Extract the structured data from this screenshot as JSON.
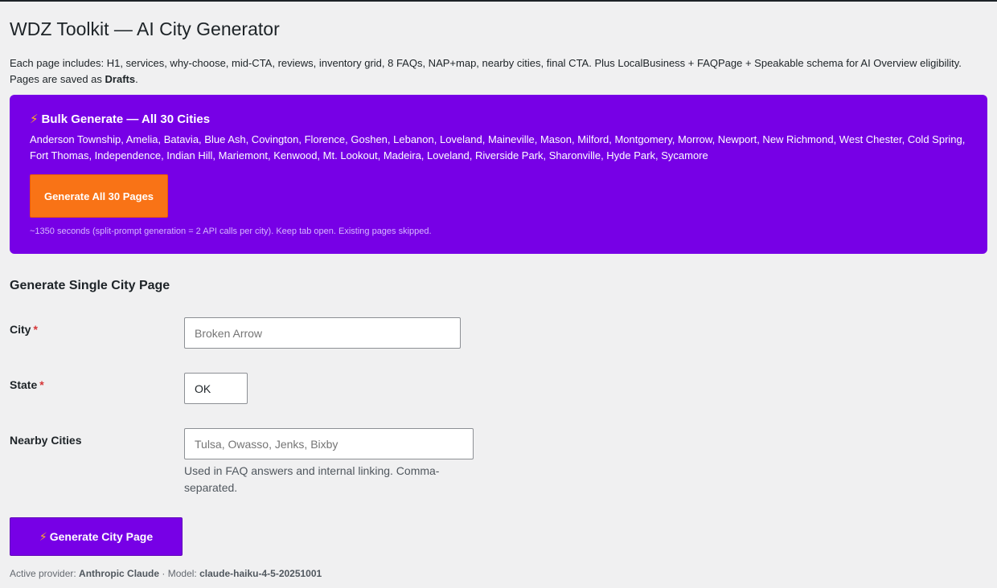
{
  "page": {
    "title": "WDZ Toolkit — AI City Generator",
    "intro_text": "Each page includes: H1, services, why-choose, mid-CTA, reviews, inventory grid, 8 FAQs, NAP+map, nearby cities, final CTA. Plus LocalBusiness + FAQPage + Speakable schema for AI Overview eligibility. Pages are saved as ",
    "intro_bold": "Drafts",
    "intro_end": "."
  },
  "bulk": {
    "icon": "lightning-bolt-icon",
    "title": "Bulk Generate — All 30 Cities",
    "cities": "Anderson Township, Amelia, Batavia, Blue Ash, Covington, Florence, Goshen, Lebanon, Loveland, Maineville, Mason, Milford, Montgomery, Morrow, Newport, New Richmond, West Chester, Cold Spring, Fort Thomas, Independence, Indian Hill, Mariemont, Kenwood, Mt. Lookout, Madeira, Loveland, Riverside Park, Sharonville, Hyde Park, Sycamore",
    "button_label": "Generate All 30 Pages",
    "note": "~1350 seconds (split-prompt generation = 2 API calls per city). Keep tab open. Existing pages skipped."
  },
  "single": {
    "title": "Generate Single City Page",
    "city": {
      "label": "City",
      "required_mark": "*",
      "value": "",
      "placeholder": "Broken Arrow"
    },
    "state": {
      "label": "State",
      "required_mark": "*",
      "value": "OK",
      "placeholder": ""
    },
    "nearby": {
      "label": "Nearby Cities",
      "value": "",
      "placeholder": "Tulsa, Owasso, Jenks, Bixby",
      "help": "Used in FAQ answers and internal linking. Comma-separated."
    },
    "button_label": "Generate City Page"
  },
  "footer": {
    "provider_label": "Active provider:",
    "provider": "Anthropic Claude",
    "separator": "·",
    "model_label": "Model:",
    "model": "claude-haiku-4-5-20251001"
  },
  "colors": {
    "accent_purple": "#7700e6",
    "bulk_button_orange": "#f97316",
    "required_red": "#d63638",
    "page_background": "#f0f0f1"
  }
}
